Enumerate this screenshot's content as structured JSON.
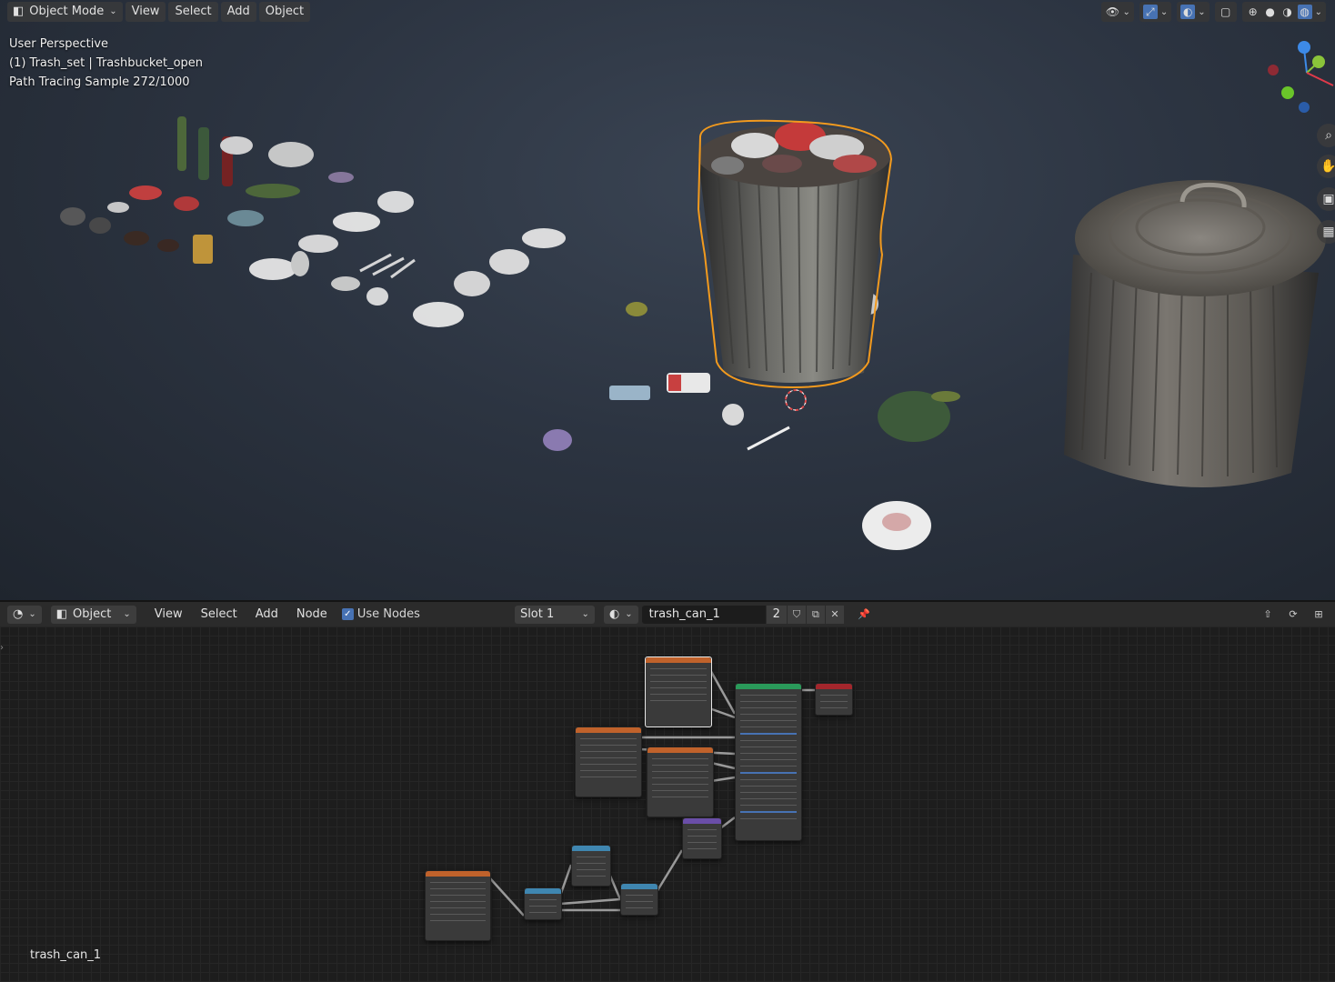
{
  "viewport": {
    "header": {
      "mode_label": "Object Mode",
      "menu": [
        "View",
        "Select",
        "Add",
        "Object"
      ]
    },
    "overlay": {
      "perspective": "User Perspective",
      "object": "(1) Trash_set | Trashbucket_open",
      "render_status": "Path Tracing Sample 272/1000"
    }
  },
  "node_editor": {
    "header": {
      "object_label": "Object",
      "menu": [
        "View",
        "Select",
        "Add",
        "Node"
      ],
      "use_nodes_label": "Use Nodes",
      "use_nodes_checked": true,
      "slot_label": "Slot 1",
      "material_name": "trash_can_1",
      "user_count": "2"
    },
    "material_label": "trash_can_1"
  },
  "colors": {
    "accent": "#4772b3",
    "selection_outline": "#f29a1e",
    "node_texture": "#c0622b",
    "node_shader": "#2a9a5a",
    "node_output": "#a3262c",
    "node_converter": "#3f86b0",
    "node_vector": "#6a4ea8"
  }
}
